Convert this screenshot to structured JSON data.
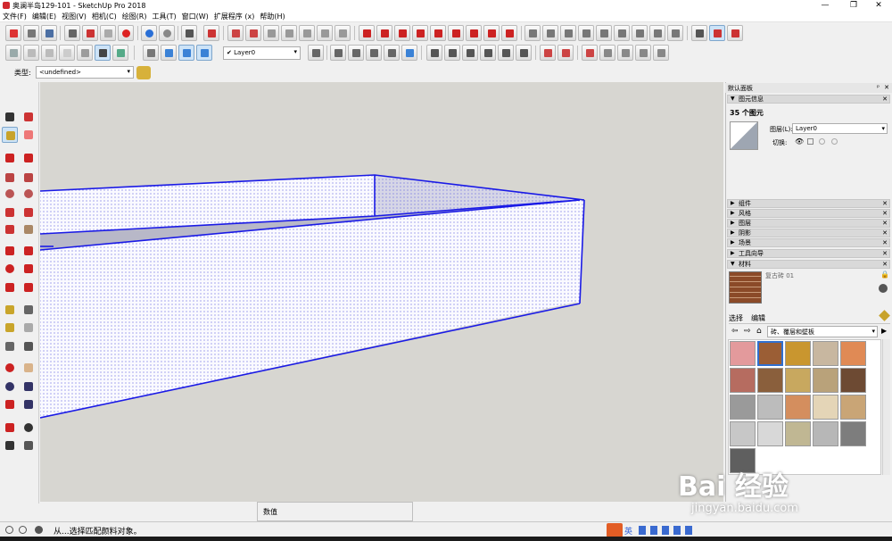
{
  "window": {
    "title": "奥澜半岛129-101 - SketchUp Pro 2018",
    "minimize": "—",
    "maximize": "❐",
    "close": "✕"
  },
  "menu": [
    "文件(F)",
    "编辑(E)",
    "视图(V)",
    "相机(C)",
    "绘图(R)",
    "工具(T)",
    "窗口(W)",
    "扩展程序 (x)",
    "帮助(H)"
  ],
  "toolbar": {
    "layer_select": "Layer0",
    "layer_check": "✔"
  },
  "type_row": {
    "label": "类型:",
    "value": "<undefined>"
  },
  "tray": {
    "title": "默认面板",
    "entity_info": {
      "header": "图元信息",
      "count": "35 个图元",
      "layer_label": "图层(L):",
      "layer_value": "Layer0",
      "toggle_label": "切换:"
    },
    "sections": [
      "组件",
      "风格",
      "图层",
      "阴影",
      "场景",
      "工具向导"
    ],
    "materials": {
      "header": "材料",
      "current": "复古砖 01",
      "tab_select": "选择",
      "tab_edit": "编辑",
      "library": "砖、覆层和壁板"
    },
    "swatch_colors": [
      "#e39a9c",
      "#9b5e35",
      "#c9962f",
      "#c8b7a0",
      "#e08a55",
      "#b66c60",
      "#8a5f3c",
      "#c8a85f",
      "#b9a27a",
      "#6d4a33",
      "#9a9a9a",
      "#bcbcbc",
      "#d48e5e",
      "#e4d5b7",
      "#c9a576",
      "#c7c7c7",
      "#d8d8d8",
      "#c0b793",
      "#b7b7b7",
      "#7d7d7d",
      "#5f5f5f"
    ]
  },
  "status": {
    "message": "从...选择匹配颜料对象。",
    "value_label": "数值"
  },
  "watermark": {
    "brand": "Bai 经验",
    "url": "jingyan.baidu.com"
  },
  "ime": {
    "lang": "英"
  },
  "colors": {
    "selection_blue": "#1a1ae6",
    "viewport_bg": "#d7d6d1"
  }
}
